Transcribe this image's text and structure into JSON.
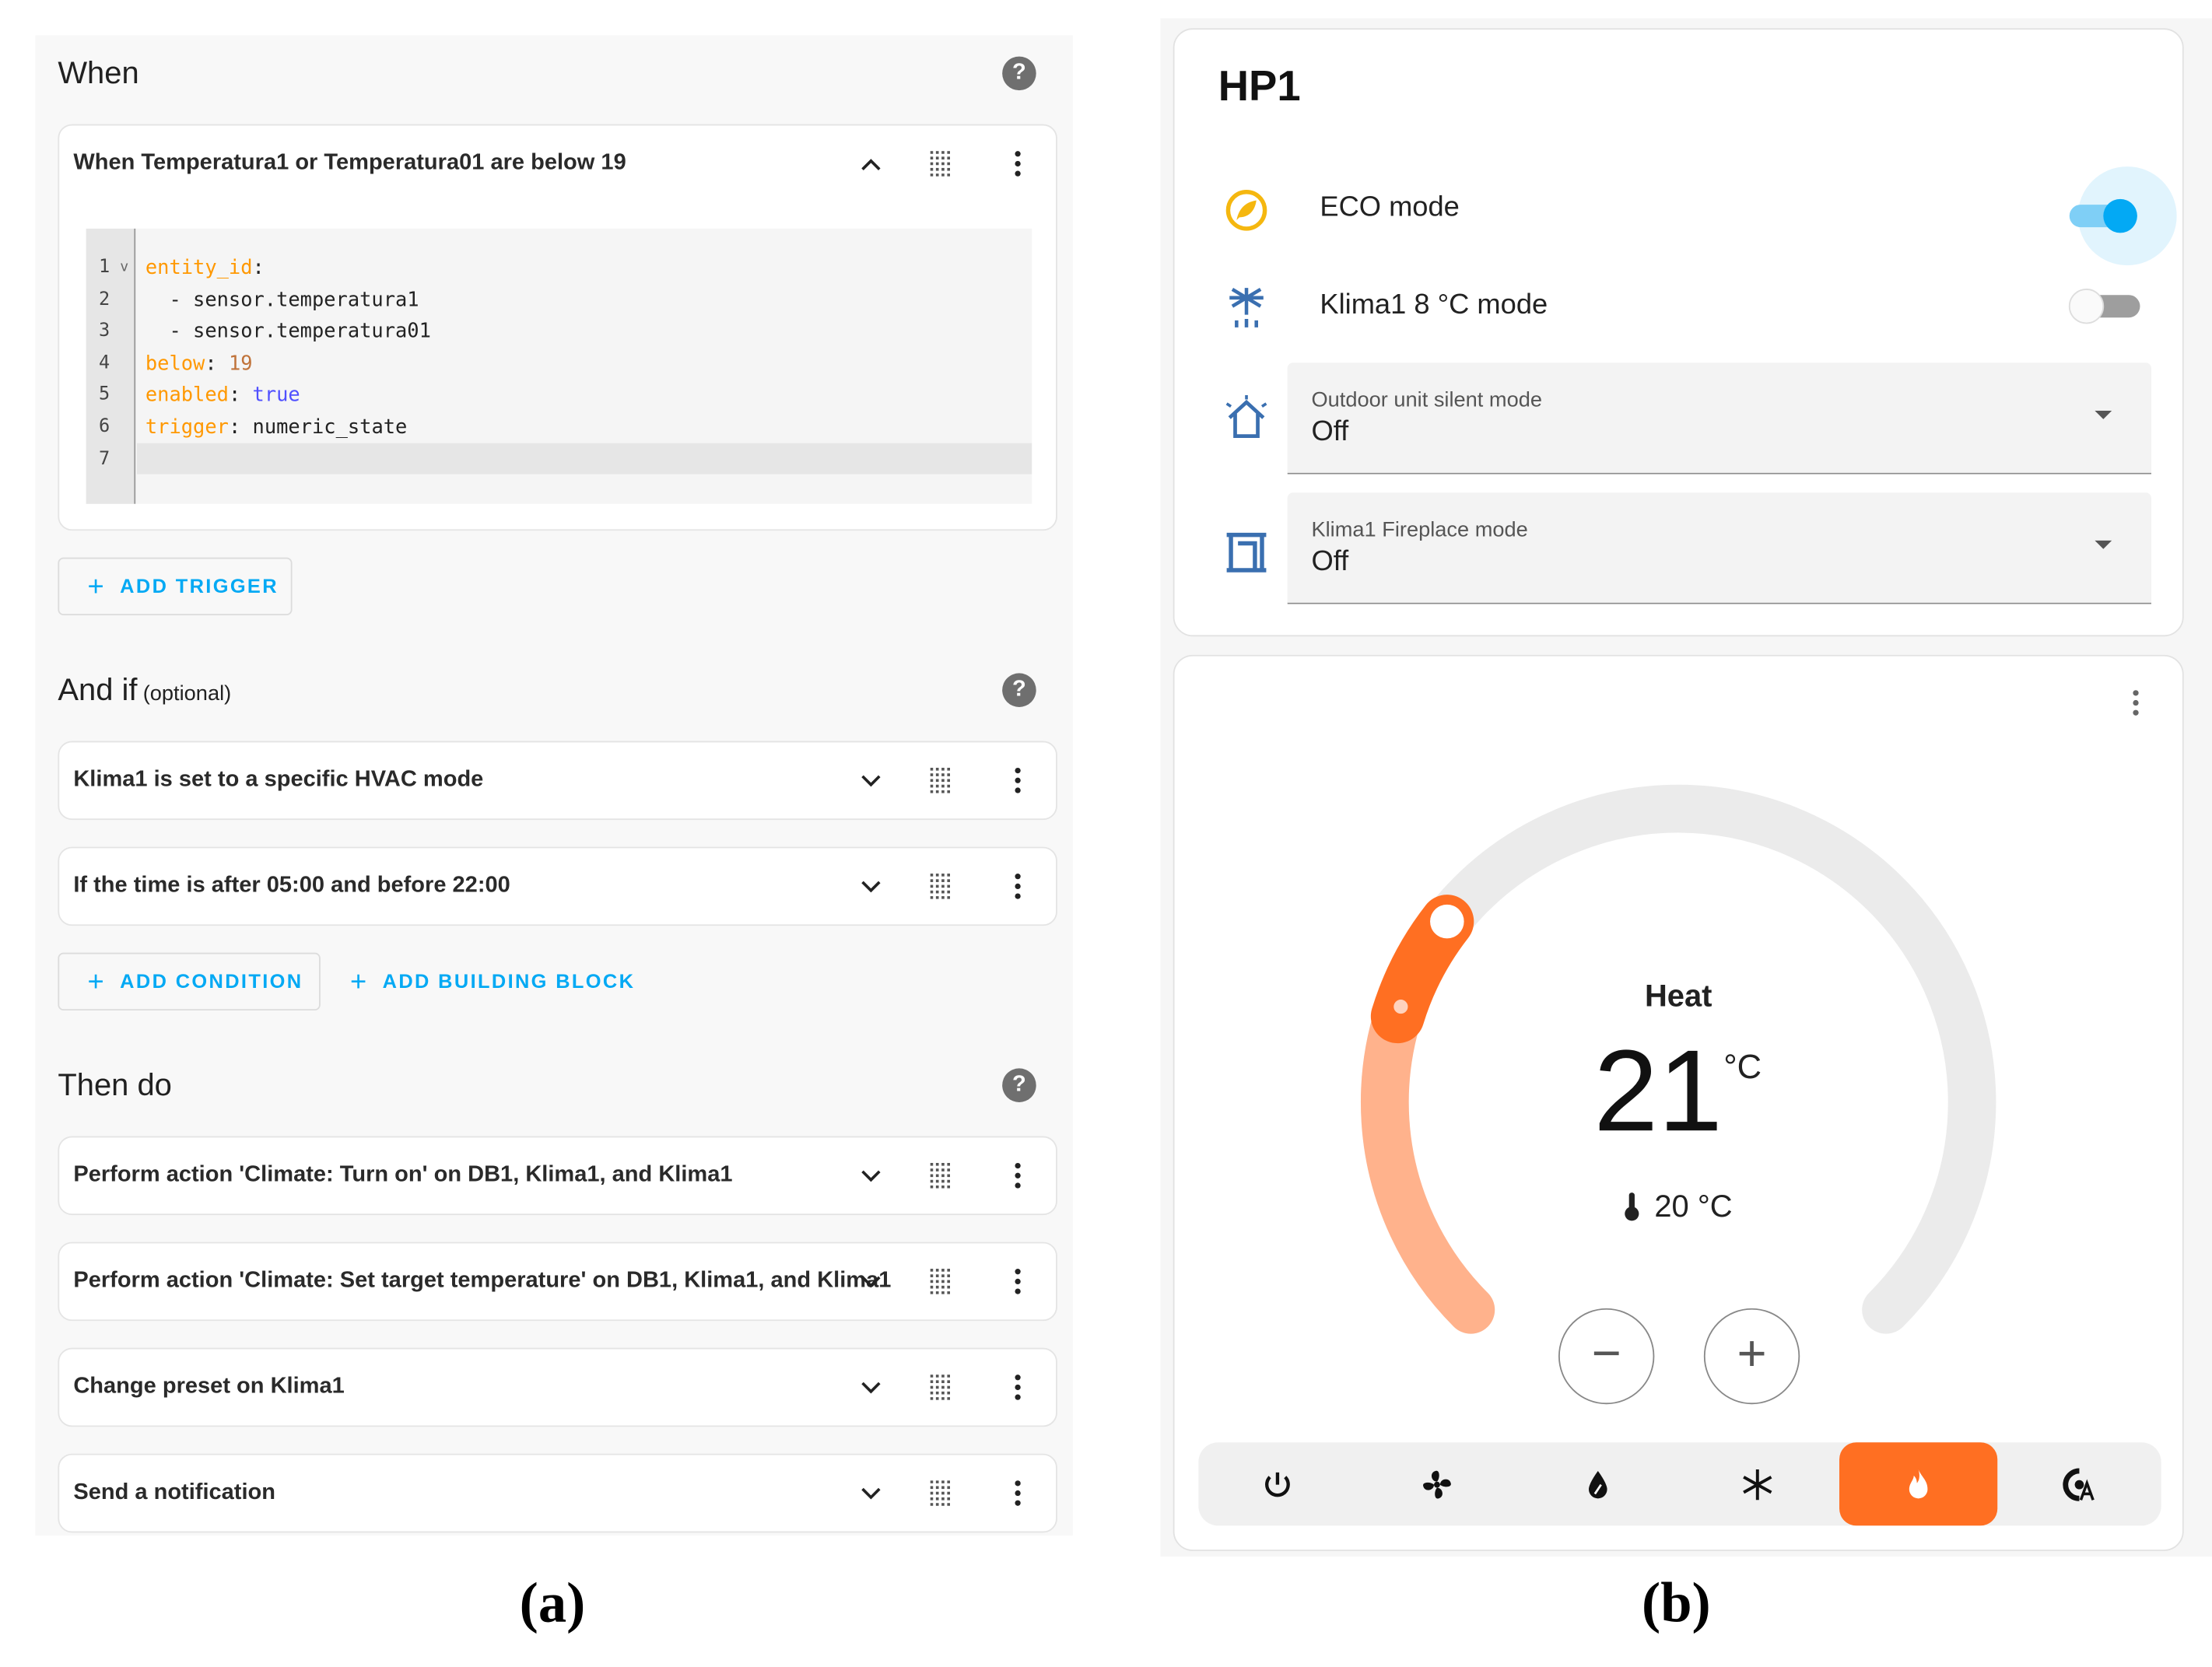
{
  "panel_a": {
    "caption": "(a)",
    "when": {
      "title": "When",
      "trigger": {
        "title": "When Temperatura1 or Temperatura01 are below 19",
        "code_lines": [
          {
            "n": "1",
            "fold": "v",
            "parts": [
              {
                "c": "k",
                "t": "entity_id"
              },
              {
                "c": "",
                "t": ":"
              }
            ]
          },
          {
            "n": "2",
            "parts": [
              {
                "c": "",
                "t": "  - sensor.temperatura1"
              }
            ]
          },
          {
            "n": "3",
            "parts": [
              {
                "c": "",
                "t": "  - sensor.temperatura01"
              }
            ]
          },
          {
            "n": "4",
            "parts": [
              {
                "c": "k",
                "t": "below"
              },
              {
                "c": "",
                "t": ": "
              },
              {
                "c": "n",
                "t": "19"
              }
            ]
          },
          {
            "n": "5",
            "parts": [
              {
                "c": "k",
                "t": "enabled"
              },
              {
                "c": "",
                "t": ": "
              },
              {
                "c": "b",
                "t": "true"
              }
            ]
          },
          {
            "n": "6",
            "parts": [
              {
                "c": "k",
                "t": "trigger"
              },
              {
                "c": "",
                "t": ": numeric_state"
              }
            ]
          },
          {
            "n": "7",
            "parts": []
          }
        ]
      },
      "add_trigger": "ADD TRIGGER"
    },
    "and_if": {
      "title": "And if",
      "optional": "(optional)",
      "conditions": [
        "Klima1 is set to a specific HVAC mode",
        "If the time is after 05:00 and before 22:00"
      ],
      "add_condition": "ADD CONDITION",
      "add_building_block": "ADD BUILDING BLOCK"
    },
    "then_do": {
      "title": "Then do",
      "actions": [
        "Perform action 'Climate: Turn on' on DB1, Klima1, and Klima1",
        "Perform action 'Climate: Set target temperature' on DB1, Klima1, and Klima1",
        "Change preset on Klima1",
        "Send a notification"
      ]
    },
    "help": "?",
    "plus": "+"
  },
  "panel_b": {
    "caption": "(b)",
    "card_title": "HP1",
    "eco_mode": {
      "label": "ECO mode",
      "on": true
    },
    "klima_8c": {
      "label": "Klima1 8 °C mode",
      "on": false
    },
    "silent": {
      "label": "Outdoor unit silent mode",
      "value": "Off"
    },
    "fireplace": {
      "label": "Klima1 Fireplace mode",
      "value": "Off"
    },
    "thermostat": {
      "mode": "Heat",
      "target": "21",
      "unit": "°C",
      "current": "20 °C",
      "minus": "−",
      "plus": "+",
      "modes": [
        "power-off",
        "fan-only",
        "dry",
        "cool",
        "heat",
        "auto"
      ],
      "active_mode": "heat"
    },
    "colors": {
      "accent": "#03a9f4",
      "heat": "#ff6f22",
      "heat_light": "#ffb28c"
    }
  }
}
